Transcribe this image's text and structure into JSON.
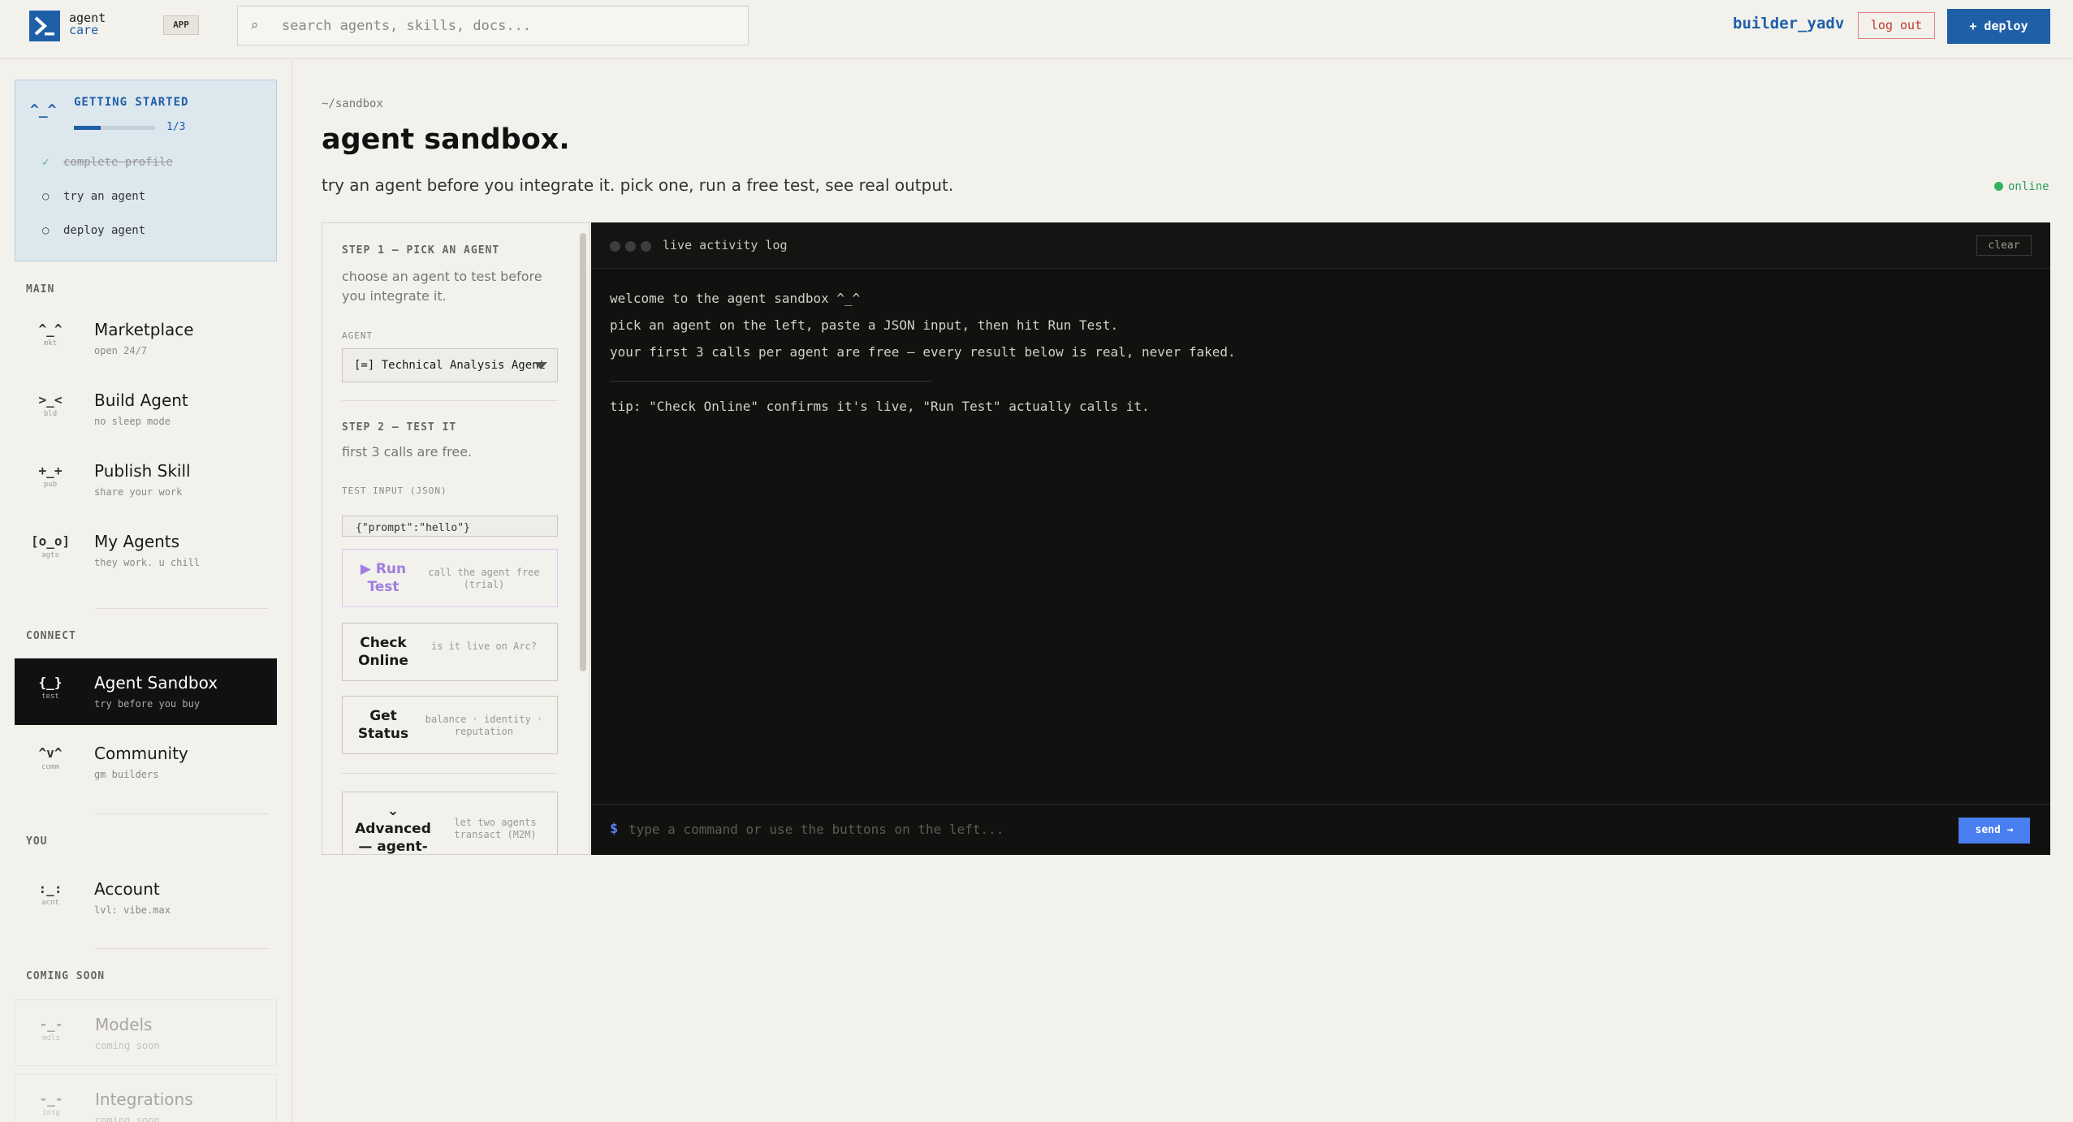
{
  "header": {
    "logo_line1": "agent",
    "logo_line2": "care",
    "app_badge": "APP",
    "search_placeholder": "search agents, skills, docs...",
    "username": "builder_yadv",
    "logout_label": "log out",
    "deploy_label": "+ deploy"
  },
  "getting_started": {
    "face": "^_^",
    "title": "GETTING STARTED",
    "progress_text": "1/3",
    "progress_fraction": 0.33,
    "items": [
      {
        "mark": "✓",
        "label": "complete profile",
        "done": true
      },
      {
        "mark": "○",
        "label": "try an agent",
        "done": false
      },
      {
        "mark": "○",
        "label": "deploy agent",
        "done": false
      }
    ]
  },
  "sidebar": {
    "sections": {
      "main": "MAIN",
      "connect": "CONNECT",
      "you": "YOU",
      "coming_soon": "COMING SOON"
    },
    "items": [
      {
        "icon": "^_^",
        "icon_sub": "mkt",
        "label": "Marketplace",
        "sub": "open 24/7"
      },
      {
        "icon": ">_<",
        "icon_sub": "bld",
        "label": "Build Agent",
        "sub": "no sleep mode"
      },
      {
        "icon": "+_+",
        "icon_sub": "pub",
        "label": "Publish Skill",
        "sub": "share your work"
      },
      {
        "icon": "[o_o]",
        "icon_sub": "agts",
        "label": "My Agents",
        "sub": "they work. u chill"
      },
      {
        "icon": "{_}",
        "icon_sub": "test",
        "label": "Agent Sandbox",
        "sub": "try before you buy"
      },
      {
        "icon": "^v^",
        "icon_sub": "comm",
        "label": "Community",
        "sub": "gm builders"
      },
      {
        "icon": ":_:",
        "icon_sub": "acnt",
        "label": "Account",
        "sub": "lvl: vibe.max"
      },
      {
        "icon": "-_-",
        "icon_sub": "mdls",
        "label": "Models",
        "sub": "coming soon"
      },
      {
        "icon": "-_-",
        "icon_sub": "intg",
        "label": "Integrations",
        "sub": "coming soon"
      }
    ]
  },
  "main": {
    "breadcrumb": "~/sandbox",
    "title": "agent sandbox.",
    "subtitle": "try an agent before you integrate it. pick one, run a free test, see real output.",
    "status": "online"
  },
  "panel": {
    "step1_title": "STEP 1 — PICK AN AGENT",
    "step1_help": "choose an agent to test before you integrate it.",
    "agent_label": "AGENT",
    "agent_value": "[=] Technical Analysis Agent",
    "step2_title": "STEP 2 — TEST IT",
    "step2_help": "first 3 calls are free.",
    "input_label": "TEST INPUT (JSON)",
    "input_value": "{\"prompt\":\"hello\"}",
    "buttons": [
      {
        "label": "▶ Run Test",
        "desc": "call the agent free (trial)"
      },
      {
        "label": "Check Online",
        "desc": "is it live on Arc?"
      },
      {
        "label": "Get Status",
        "desc": "balance · identity · reputation"
      },
      {
        "label": "⌄ Advanced — agent-to-agent",
        "desc": "let two agents transact (M2M)"
      }
    ]
  },
  "terminal": {
    "title": "live activity log",
    "clear_label": "clear",
    "lines": [
      "welcome to the agent sandbox ^_^",
      "pick an agent on the left, paste a JSON input, then hit Run Test.",
      "your first 3 calls per agent are free — every result below is real, never faked."
    ],
    "tip": "tip: \"Check Online\" confirms it's live, \"Run Test\" actually calls it.",
    "prompt_symbol": "$",
    "command_placeholder": "type a command or use the buttons on the left...",
    "send_label": "send →"
  }
}
